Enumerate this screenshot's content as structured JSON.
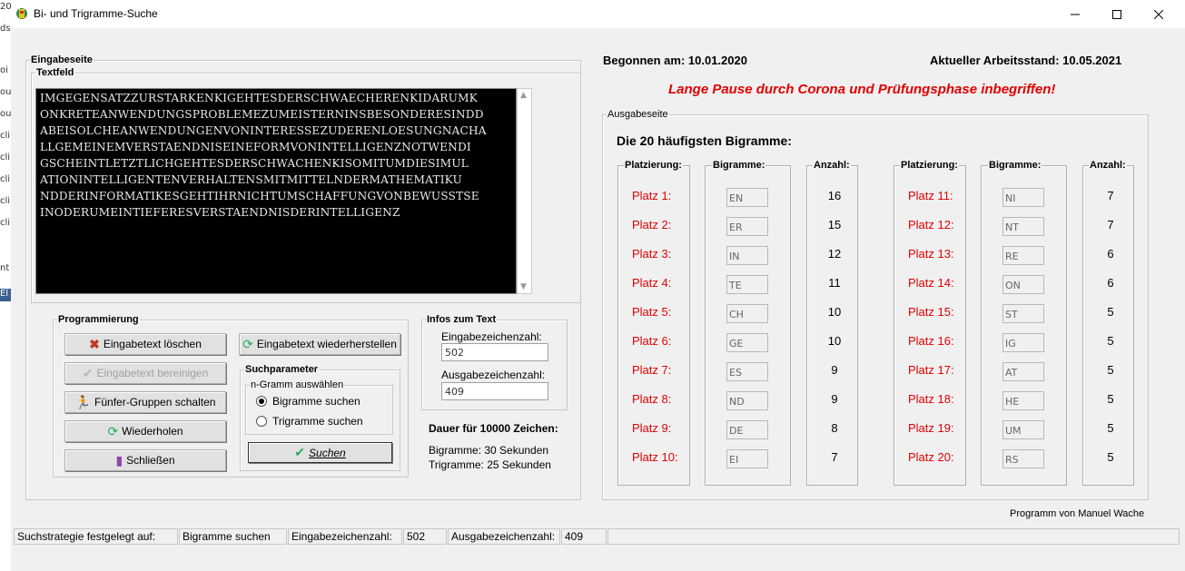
{
  "window": {
    "title": "Bi- und Trigramme-Suche"
  },
  "input_page": {
    "group_label": "Eingabeseite",
    "textfield_label": "Textfeld",
    "text_lines": [
      "IMGEGENSATZZURSTARKENKIGEHTESDERSCHWAECHERENKIDARUMK",
      "ONKRETEANWENDUNGSPROBLEMEZUMEISTERNINSBESONDERESINDD",
      "ABEISOLCHEANWENDUNGENVONINTERESSEZUDERENLOESUNGNACHA",
      "LLGEMEINEMVERSTAENDNISEINEFORMVONINTELLIGENZNOTWENDI",
      "GSCHEINTLETZTLICHGEHTESDERSCHWACHENKISOMITUMDIESIMUL",
      "ATIONINTELLIGENTENVERHALTENSMITMITTELNDERMATHEMATIKU",
      "NDDERINFORMATIKESGEHTIHRNICHTUMSCHAFFUNGVONBEWUSSTSE",
      "INODERUMEINTIEFERESVERSTAENDNISDERINTELLIGENZ"
    ]
  },
  "programming": {
    "group_label": "Programmierung",
    "buttons": {
      "clear": "Eingabetext löschen",
      "restore": "Eingabetext wiederherstellen",
      "clean": "Eingabetext bereinigen",
      "groups": "Fünfer-Gruppen schalten",
      "repeat": "Wiederholen",
      "close": "Schließen",
      "search": "Suchen"
    },
    "search_params": {
      "group_label": "Suchparameter",
      "ngram_label": "n-Gramm auswählen",
      "option_bigram": "Bigramme suchen",
      "option_trigram": "Trigramme suchen",
      "selected": "bigram"
    }
  },
  "infos": {
    "group_label": "Infos zum Text",
    "input_count_label": "Eingabezeichenzahl:",
    "input_count_value": "502",
    "output_count_label": "Ausgabezeichenzahl:",
    "output_count_value": "409",
    "duration_title": "Dauer für 10000 Zeichen:",
    "duration_bigram": "Bigramme: 30 Sekunden",
    "duration_trigram": "Trigramme: 25 Sekunden"
  },
  "header": {
    "started": "Begonnen am: 10.01.2020",
    "current": "Aktueller Arbeitsstand: 10.05.2021",
    "pause_note": "Lange Pause durch Corona und Prüfungsphase inbegriffen!"
  },
  "output_page": {
    "group_label": "Ausgabeseite",
    "heading": "Die 20 häufigsten Bigramme:",
    "col_rank": "Platzierung:",
    "col_bigram": "Bigramme:",
    "col_count": "Anzahl:",
    "rows_left": [
      {
        "rank": "Platz 1:",
        "bigram": "EN",
        "count": "16"
      },
      {
        "rank": "Platz 2:",
        "bigram": "ER",
        "count": "15"
      },
      {
        "rank": "Platz 3:",
        "bigram": "IN",
        "count": "12"
      },
      {
        "rank": "Platz 4:",
        "bigram": "TE",
        "count": "11"
      },
      {
        "rank": "Platz 5:",
        "bigram": "CH",
        "count": "10"
      },
      {
        "rank": "Platz 6:",
        "bigram": "GE",
        "count": "10"
      },
      {
        "rank": "Platz 7:",
        "bigram": "ES",
        "count": "9"
      },
      {
        "rank": "Platz 8:",
        "bigram": "ND",
        "count": "9"
      },
      {
        "rank": "Platz 9:",
        "bigram": "DE",
        "count": "8"
      },
      {
        "rank": "Platz 10:",
        "bigram": "EI",
        "count": "7"
      }
    ],
    "rows_right": [
      {
        "rank": "Platz 11:",
        "bigram": "NI",
        "count": "7"
      },
      {
        "rank": "Platz 12:",
        "bigram": "NT",
        "count": "7"
      },
      {
        "rank": "Platz 13:",
        "bigram": "RE",
        "count": "6"
      },
      {
        "rank": "Platz 14:",
        "bigram": "ON",
        "count": "6"
      },
      {
        "rank": "Platz 15:",
        "bigram": "ST",
        "count": "5"
      },
      {
        "rank": "Platz 16:",
        "bigram": "IG",
        "count": "5"
      },
      {
        "rank": "Platz 17:",
        "bigram": "AT",
        "count": "5"
      },
      {
        "rank": "Platz 18:",
        "bigram": "HE",
        "count": "5"
      },
      {
        "rank": "Platz 19:",
        "bigram": "UM",
        "count": "5"
      },
      {
        "rank": "Platz 20:",
        "bigram": "RS",
        "count": "5"
      }
    ]
  },
  "footer": {
    "author": "Programm von Manuel Wache"
  },
  "statusbar": {
    "strategy_label": "Suchstrategie festgelegt auf:",
    "strategy_value": "Bigramme suchen",
    "input_label": "Eingabezeichenzahl:",
    "input_value": "502",
    "output_label": "Ausgabezeichenzahl:",
    "output_value": "409"
  },
  "desktop_edge": {
    "fragments": [
      "20",
      "ds",
      "oi",
      "ou",
      "ou",
      "cli",
      "cli",
      "cli",
      "cli",
      "cli",
      "nt",
      "El"
    ]
  },
  "colors": {
    "accent_red": "#e00000",
    "text_bg": "#000000",
    "text_fg": "#e8e8e8"
  }
}
